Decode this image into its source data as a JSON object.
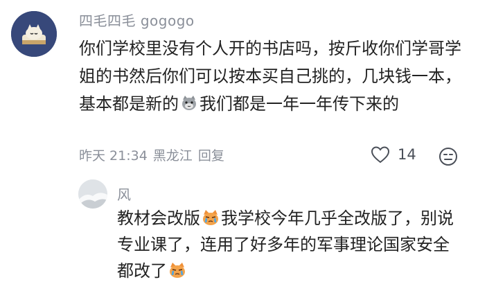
{
  "comment": {
    "username": "四毛四毛 gogogo",
    "text_part1": "你们学校里没有个人开的书店吗，按斤收你们学哥学姐的书然后你们可以按本买自己挑的，几块钱一本，基本都是新的",
    "text_part2": "我们都是一年一年传下来的",
    "time": "昨天 21:34",
    "location": "黑龙江",
    "reply_label": "回复",
    "like_count": "14",
    "emoji_inline": "cat-emoji"
  },
  "reply": {
    "username": "风",
    "text_part1": "教材会改版",
    "text_part2": "我学校今年几乎全改版了，别说专业课了，连用了好多年的军事理论国家安全都改了",
    "emoji_inline": "crying-cat-emoji"
  },
  "icons": {
    "like": "heart-icon",
    "dislike": "unhappy-face-icon"
  },
  "colors": {
    "username": "#8a8f99",
    "text": "#222222",
    "avatar_bg": "#37487a"
  }
}
